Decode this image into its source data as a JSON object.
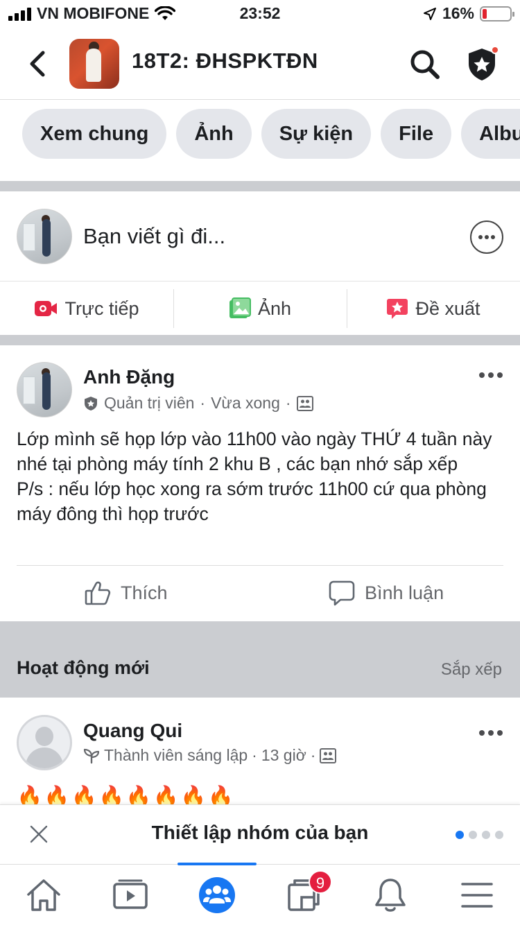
{
  "status_bar": {
    "carrier": "VN MOBIFONE",
    "time": "23:52",
    "battery_percent": "16%",
    "battery_level": 0.16
  },
  "header": {
    "group_name": "18T2: ĐHSPKTĐN",
    "icons": [
      "back-chevron-icon",
      "search-icon",
      "shield-star-icon"
    ]
  },
  "tabs": [
    {
      "label": "Xem chung"
    },
    {
      "label": "Ảnh"
    },
    {
      "label": "Sự kiện"
    },
    {
      "label": "File"
    },
    {
      "label": "Album"
    }
  ],
  "composer": {
    "placeholder": "Bạn viết gì đi...",
    "actions": [
      {
        "label": "Trực tiếp",
        "icon": "live-video-icon",
        "color": "#e42645"
      },
      {
        "label": "Ảnh",
        "icon": "photo-icon",
        "color": "#45bd62"
      },
      {
        "label": "Đề xuất",
        "icon": "recommend-star-icon",
        "color": "#f3425f"
      }
    ]
  },
  "post": {
    "author": "Anh Đặng",
    "role": "Quản trị viên",
    "time": "Vừa xong",
    "text_lines": [
      "Lớp mình sẽ họp lớp vào 11h00 vào ngày THỨ 4 tuần này nhé tại phòng máy tính 2 khu B , các bạn nhớ sắp xếp",
      "P/s : nếu lớp học xong ra sớm trước 11h00 cứ qua phòng máy đông thì họp trước"
    ],
    "like_label": "Thích",
    "comment_label": "Bình luận"
  },
  "activity": {
    "title": "Hoạt động mới",
    "sort_label": "Sắp xếp"
  },
  "post2": {
    "author": "Quang Qui",
    "role": "Thành viên sáng lập",
    "time": "13 giờ",
    "content": "🔥🔥🔥🔥🔥🔥🔥🔥"
  },
  "setup_banner": {
    "title": "Thiết lập nhóm của bạn",
    "page_count": 4,
    "active_page": 1
  },
  "bottom_nav": {
    "items": [
      {
        "name": "home-icon"
      },
      {
        "name": "watch-icon"
      },
      {
        "name": "groups-icon",
        "active": true
      },
      {
        "name": "pages-icon",
        "badge": "9"
      },
      {
        "name": "notifications-bell-icon"
      },
      {
        "name": "menu-icon"
      }
    ],
    "accent_color": "#1877f2"
  }
}
